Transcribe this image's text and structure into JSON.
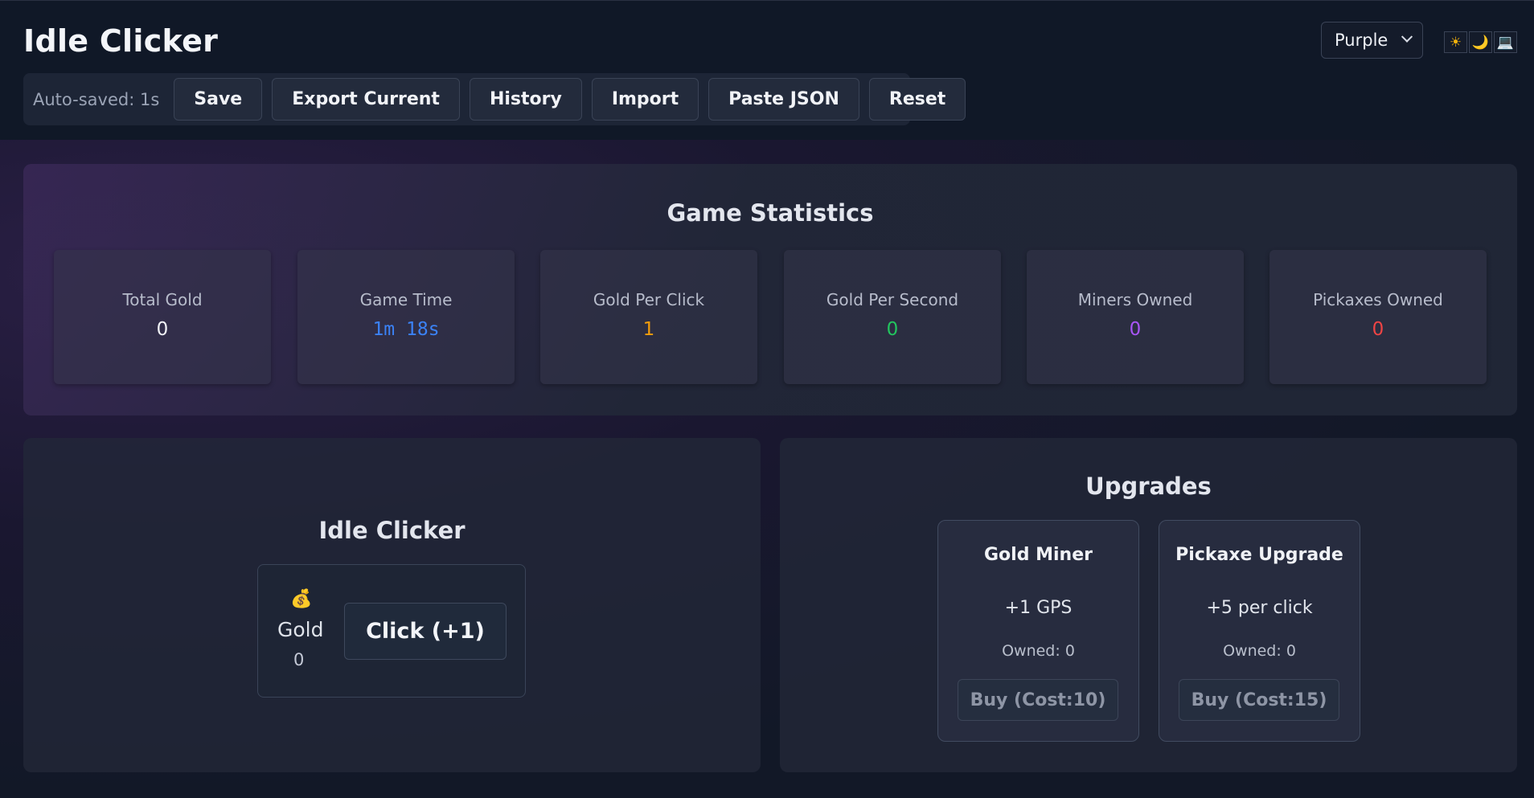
{
  "header": {
    "title": "Idle Clicker",
    "autosave": "Auto-saved: 1s",
    "buttons": {
      "save": "Save",
      "export": "Export Current",
      "history": "History",
      "import": "Import",
      "paste": "Paste JSON",
      "reset": "Reset"
    },
    "theme": {
      "selected": "Purple"
    },
    "mode_icons": {
      "light": "☀",
      "dark": "🌙",
      "system": "💻"
    }
  },
  "stats": {
    "title": "Game Statistics",
    "items": [
      {
        "label": "Total Gold",
        "value": "0",
        "color": "#f1f3f7"
      },
      {
        "label": "Game Time",
        "value": "1m 18s",
        "color": "#3b82f6"
      },
      {
        "label": "Gold Per Click",
        "value": "1",
        "color": "#f59e0b"
      },
      {
        "label": "Gold Per Second",
        "value": "0",
        "color": "#22c55e"
      },
      {
        "label": "Miners Owned",
        "value": "0",
        "color": "#a855f7"
      },
      {
        "label": "Pickaxes Owned",
        "value": "0",
        "color": "#ef4444"
      }
    ]
  },
  "clicker": {
    "title": "Idle Clicker",
    "icon": "money-bag",
    "gold_label": "Gold",
    "gold_value": "0",
    "click_label": "Click (+1)"
  },
  "upgrades": {
    "title": "Upgrades",
    "items": [
      {
        "name": "Gold Miner",
        "effect": "+1 GPS",
        "owned_label": "Owned:",
        "owned": "0",
        "buy_label": "Buy (Cost:10)"
      },
      {
        "name": "Pickaxe Upgrade",
        "effect": "+5 per click",
        "owned_label": "Owned:",
        "owned": "0",
        "buy_label": "Buy (Cost:15)"
      }
    ]
  }
}
